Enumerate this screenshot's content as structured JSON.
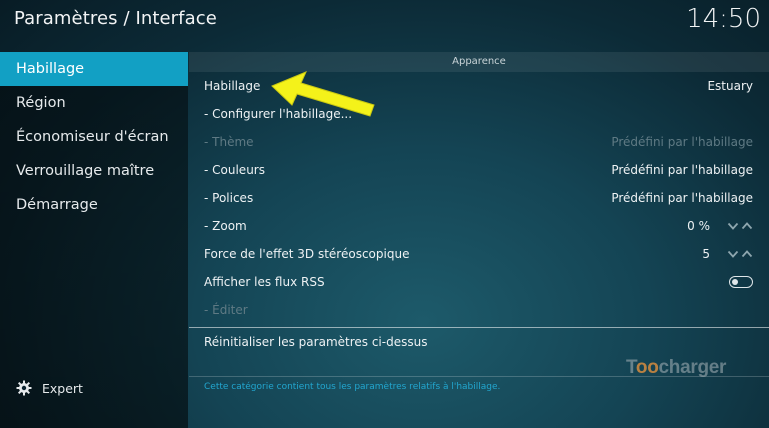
{
  "header": {
    "title": "Paramètres / Interface",
    "clock": "14:50"
  },
  "sidebar": {
    "items": [
      {
        "label": "Habillage",
        "active": true
      },
      {
        "label": "Région"
      },
      {
        "label": "Économiseur d'écran"
      },
      {
        "label": "Verrouillage maître"
      },
      {
        "label": "Démarrage"
      }
    ],
    "expert": {
      "label": "Expert",
      "icon": "gear-icon"
    }
  },
  "main": {
    "section_title": "Apparence",
    "rows": [
      {
        "label": "Habillage",
        "value": "Estuary"
      },
      {
        "label": "- Configurer l'habillage...",
        "value": ""
      },
      {
        "label": "- Thème",
        "value": "Prédéfini par l'habillage",
        "disabled": true
      },
      {
        "label": "- Couleurs",
        "value": "Prédéfini par l'habillage"
      },
      {
        "label": "- Polices",
        "value": "Prédéfini par l'habillage"
      },
      {
        "label": "- Zoom",
        "value": "0 %"
      },
      {
        "label": "Force de l'effet 3D stéréoscopique",
        "value": "5"
      },
      {
        "label": "Afficher les flux RSS",
        "value": "",
        "toggle": false
      },
      {
        "label": "- Éditer",
        "value": "",
        "disabled": true
      }
    ],
    "reset_label": "Réinitialiser les paramètres ci-dessus",
    "info": "Cette catégorie contient tous les paramètres relatifs à l'habillage."
  },
  "watermark": {
    "pre": "T",
    "oo": "oo",
    "post": "charger"
  },
  "colors": {
    "accent": "#12a0c4",
    "info": "#22a6cf",
    "arrow": "#f4f21a"
  }
}
